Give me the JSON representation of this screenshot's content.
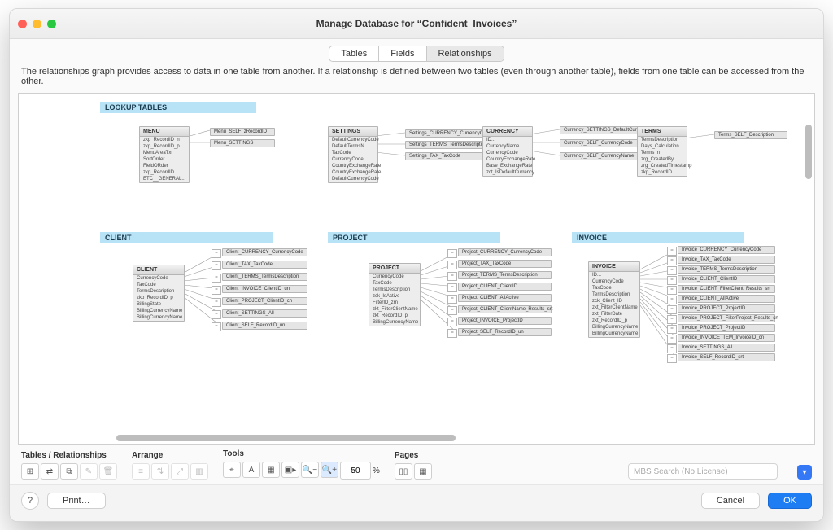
{
  "window": {
    "title": "Manage Database for “Confident_Invoices”"
  },
  "tabs": {
    "tables": "Tables",
    "fields": "Fields",
    "relationships": "Relationships",
    "active": "relationships"
  },
  "description": "The relationships graph provides access to data in one table from another. If a relationship is defined between two tables (even through another table), fields from one table can be accessed from the other.",
  "sections": {
    "lookup": "LOOKUP TABLES",
    "client": "CLIENT",
    "project": "PROJECT",
    "invoice": "INVOICE"
  },
  "tables": {
    "menu": {
      "name": "MENU",
      "fields": [
        "zkp_RecordID_n",
        "zkp_RecordID_p",
        "MenuAreaTxt",
        "SortOrder",
        "FieldORder",
        "zkp_RecordID",
        "ETC__GENERAL..."
      ]
    },
    "settings": {
      "name": "SETTINGS",
      "fields": [
        "DefaultCurrencyCode",
        "DefaultTermsN",
        "TaxCode",
        "CurrencyCode",
        "CountryExchangeRate",
        "CountryExchangeRate",
        "DefaultCurrencyCode"
      ]
    },
    "currency": {
      "name": "CURRENCY",
      "fields": [
        "ID...",
        "CurrencyName",
        "CurrencyCode",
        "CountryExchangeRate",
        "Base_ExchangeRate",
        "zct_IsDefaultCurrency"
      ]
    },
    "terms": {
      "name": "TERMS",
      "fields": [
        "TermsDescription",
        "Days_Calculation",
        "Terms_n",
        "zrg_CreatedBy",
        "zrg_CreatedTimestamp",
        "zkp_RecordID"
      ]
    },
    "client": {
      "name": "CLIENT",
      "fields": [
        "CurrencyCode",
        "TaxCode",
        "TermsDescription",
        "zkp_RecordID_p",
        "BillingState",
        "BillingCurrencyName",
        "BillingCurrencyName"
      ]
    },
    "project": {
      "name": "PROJECT",
      "fields": [
        "CurrencyCode",
        "TaxCode",
        "TermsDescription",
        "zck_IsActive",
        "FilterID_zrn",
        "zkt_FilterClientName",
        "zkt_RecordID_p",
        "BillingCurrencyName"
      ]
    },
    "invoice": {
      "name": "INVOICE",
      "fields": [
        "ID...",
        "CurrencyCode",
        "TaxCode",
        "TermsDescription",
        "zck_Client_ID",
        "zkt_FilterClientName",
        "zkt_FilterDate",
        "zkt_RecordID_p",
        "BillingCurrencyName",
        "BillingCurrencyName"
      ]
    }
  },
  "related": {
    "menu": [
      "Menu_SELF_zRecordID",
      "Menu_SETTINGS"
    ],
    "settings": [
      "Settings_CURRENCY_CurrencyCode",
      "Settings_TERMS_TermsDescription",
      "Settings_TAX_TaxCode"
    ],
    "currency": [
      "Currency_SETTINGS_DefaultCurrency",
      "Currency_SELF_CurrencyCode",
      "Currency_SELF_CurrencyName"
    ],
    "terms": [
      "Terms_SELF_Description"
    ],
    "client": [
      "Client_CURRENCY_CurrencyCode",
      "Client_TAX_TaxCode",
      "Client_TERMS_TermsDescription",
      "Client_INVOICE_ClientID_un",
      "Client_PROJECT_ClientID_cn",
      "Client_SETTINGS_All",
      "Client_SELF_RecordID_un"
    ],
    "project": [
      "Project_CURRENCY_CurrencyCode",
      "Project_TAX_TaxCode",
      "Project_TERMS_TermsDescription",
      "Project_CLIENT_ClientID",
      "Project_CLIENT_AllActive",
      "Project_CLIENT_ClientName_Results_srt",
      "Project_INVOICE_ProjectID",
      "Project_SELF_RecordID_un"
    ],
    "invoice": [
      "Invoice_CURRENCY_CurrencyCode",
      "Invoice_TAX_TaxCode",
      "Invoice_TERMS_TermsDescription",
      "Invoice_CLIENT_ClientID",
      "Invoice_CLIENT_FilterClient_Results_srt",
      "Invoice_CLIENT_AllActive",
      "Invoice_PROJECT_ProjectID",
      "Invoice_PROJECT_FilterProject_Results_srt",
      "Invoice_PROJECT_ProjectID",
      "Invoice_INVOICE ITEM_InvoiceID_cn",
      "Invoice_SETTINGS_All",
      "Invoice_SELF_RecordID_srt"
    ]
  },
  "toolbar": {
    "tables_rel": "Tables / Relationships",
    "arrange": "Arrange",
    "tools": "Tools",
    "pages": "Pages",
    "zoom_value": "50",
    "zoom_unit": "%",
    "search_placeholder": "MBS Search (No License)"
  },
  "footer": {
    "help": "?",
    "print": "Print…",
    "cancel": "Cancel",
    "ok": "OK"
  }
}
